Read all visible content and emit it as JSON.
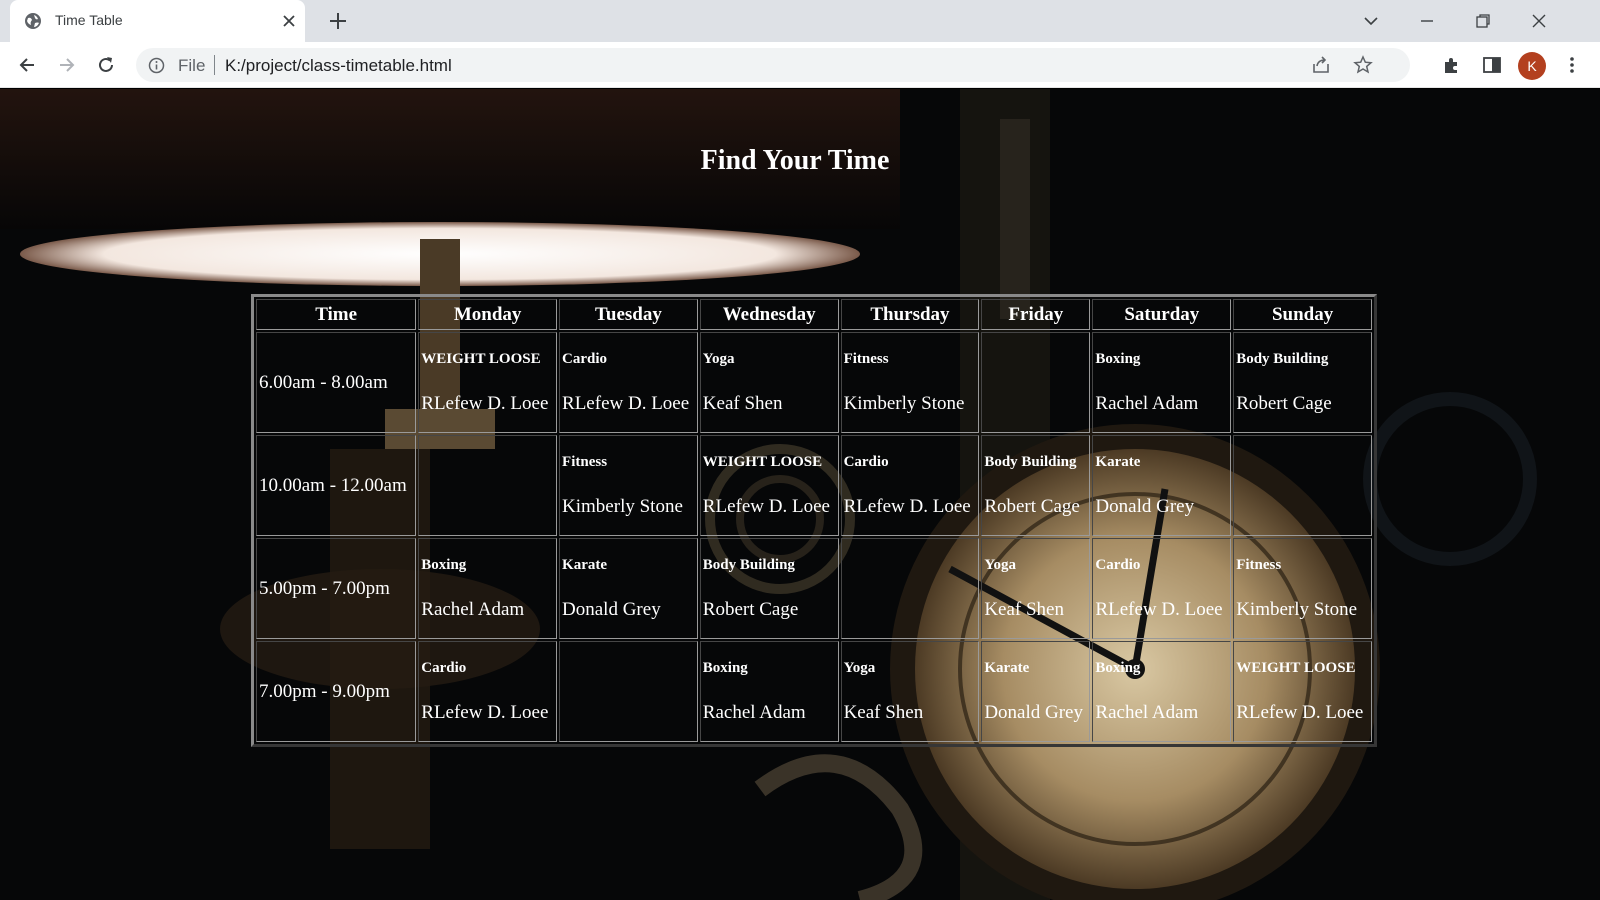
{
  "browser": {
    "tab_title": "Time Table",
    "omnibox_prefix": "File",
    "url": "K:/project/class-timetable.html",
    "profile_initial": "K",
    "profile_color": "#b3401f"
  },
  "page": {
    "heading": "Find Your Time"
  },
  "timetable": {
    "headers": [
      "Time",
      "Monday",
      "Tuesday",
      "Wednesday",
      "Thursday",
      "Friday",
      "Saturday",
      "Sunday"
    ],
    "rows": [
      {
        "time": "6.00am - 8.00am",
        "cells": [
          {
            "class": "WEIGHT LOOSE",
            "teacher": "RLefew D. Loee"
          },
          {
            "class": "Cardio",
            "teacher": "RLefew D. Loee"
          },
          {
            "class": "Yoga",
            "teacher": "Keaf Shen"
          },
          {
            "class": "Fitness",
            "teacher": "Kimberly Stone"
          },
          {
            "class": "",
            "teacher": ""
          },
          {
            "class": "Boxing",
            "teacher": "Rachel Adam"
          },
          {
            "class": "Body Building",
            "teacher": "Robert Cage"
          }
        ]
      },
      {
        "time": "10.00am - 12.00am",
        "cells": [
          {
            "class": "",
            "teacher": ""
          },
          {
            "class": "Fitness",
            "teacher": "Kimberly Stone"
          },
          {
            "class": "WEIGHT LOOSE",
            "teacher": "RLefew D. Loee"
          },
          {
            "class": "Cardio",
            "teacher": "RLefew D. Loee"
          },
          {
            "class": "Body Building",
            "teacher": "Robert Cage"
          },
          {
            "class": "Karate",
            "teacher": "Donald Grey"
          },
          {
            "class": "",
            "teacher": ""
          }
        ]
      },
      {
        "time": "5.00pm - 7.00pm",
        "cells": [
          {
            "class": "Boxing",
            "teacher": "Rachel Adam"
          },
          {
            "class": "Karate",
            "teacher": "Donald Grey"
          },
          {
            "class": "Body Building",
            "teacher": "Robert Cage"
          },
          {
            "class": "",
            "teacher": ""
          },
          {
            "class": "Yoga",
            "teacher": "Keaf Shen"
          },
          {
            "class": "Cardio",
            "teacher": "RLefew D. Loee"
          },
          {
            "class": "Fitness",
            "teacher": "Kimberly Stone"
          }
        ]
      },
      {
        "time": "7.00pm - 9.00pm",
        "cells": [
          {
            "class": "Cardio",
            "teacher": "RLefew D. Loee"
          },
          {
            "class": "",
            "teacher": ""
          },
          {
            "class": "Boxing",
            "teacher": "Rachel Adam"
          },
          {
            "class": "Yoga",
            "teacher": "Keaf Shen"
          },
          {
            "class": "Karate",
            "teacher": "Donald Grey"
          },
          {
            "class": "Boxing",
            "teacher": "Rachel Adam"
          },
          {
            "class": "WEIGHT LOOSE",
            "teacher": "RLefew D. Loee"
          }
        ]
      }
    ]
  }
}
